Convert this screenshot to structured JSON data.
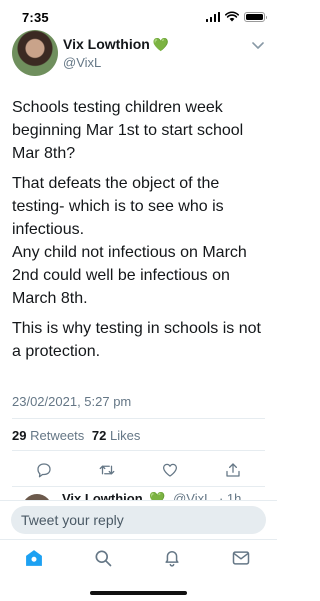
{
  "status_bar": {
    "time": "7:35"
  },
  "author": {
    "name": "Vix Lowthion",
    "badge": "💚",
    "handle": "@VixL"
  },
  "tweet": {
    "paragraphs": [
      "Schools testing children week beginning Mar 1st to start school Mar 8th?",
      "That defeats the object of the testing- which is to see who is infectious.",
      "Any child not infectious on March 2nd could well be infectious on March 8th.",
      "This is why testing in schools is not a protection."
    ],
    "timestamp": "23/02/2021, 5:27 pm"
  },
  "stats": {
    "retweets_count": "29",
    "retweets_label": "Retweets",
    "likes_count": "72",
    "likes_label": "Likes"
  },
  "actions": [
    {
      "name": "reply",
      "icon": "reply-icon"
    },
    {
      "name": "retweet",
      "icon": "retweet-icon"
    },
    {
      "name": "like",
      "icon": "heart-icon"
    },
    {
      "name": "share",
      "icon": "share-icon"
    }
  ],
  "reply_preview": {
    "name": "Vix Lowthion",
    "badge": "💚",
    "handle": "@VixL",
    "time": "· 1h"
  },
  "composer": {
    "placeholder": "Tweet your reply"
  },
  "tabs": [
    {
      "name": "home",
      "icon": "home-icon",
      "active": true
    },
    {
      "name": "search",
      "icon": "search-icon",
      "active": false
    },
    {
      "name": "notifications",
      "icon": "bell-icon",
      "active": false
    },
    {
      "name": "messages",
      "icon": "mail-icon",
      "active": false
    }
  ],
  "colors": {
    "accent": "#1da1f2",
    "text": "#14171a",
    "secondary": "#657786",
    "divider": "#e6ecf0",
    "badge": "#2ecc40"
  }
}
